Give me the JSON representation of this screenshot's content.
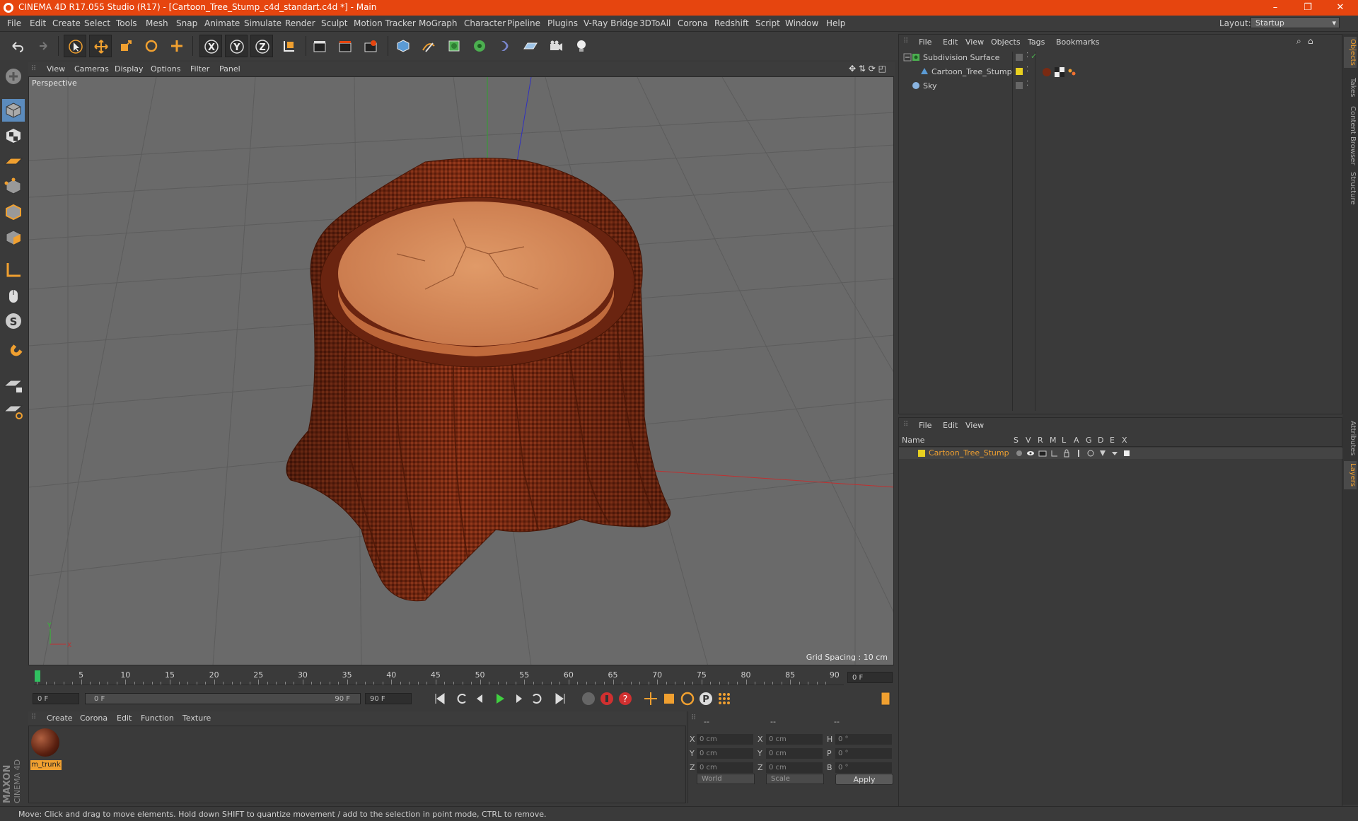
{
  "window": {
    "title": "CINEMA 4D R17.055 Studio (R17) - [Cartoon_Tree_Stump_c4d_standart.c4d *] - Main",
    "buttons": {
      "minimize": "–",
      "restore": "❐",
      "close": "✕"
    }
  },
  "menu": [
    "File",
    "Edit",
    "Create",
    "Select",
    "Tools",
    "Mesh",
    "Snap",
    "Animate",
    "Simulate",
    "Render",
    "Sculpt",
    "Motion Tracker",
    "MoGraph",
    "Character",
    "Pipeline",
    "Plugins",
    "V-Ray Bridge",
    "3DToAll",
    "Corona",
    "Redshift",
    "Script",
    "Window",
    "Help"
  ],
  "layout": {
    "label": "Layout:",
    "value": "Startup"
  },
  "viewport": {
    "menu": [
      "View",
      "Cameras",
      "Display",
      "Options",
      "Filter",
      "Panel"
    ],
    "label": "Perspective",
    "grid_spacing": "Grid Spacing : 10 cm"
  },
  "timeline": {
    "ticks": [
      "0",
      "5",
      "10",
      "15",
      "20",
      "25",
      "30",
      "35",
      "40",
      "45",
      "50",
      "55",
      "60",
      "65",
      "70",
      "75",
      "80",
      "85",
      "90"
    ],
    "current_frame": "0 F"
  },
  "playback": {
    "start": "0 F",
    "range_start": "0 F",
    "range_end": "90 F",
    "end": "90 F"
  },
  "material_manager": {
    "menu": [
      "Create",
      "Corona",
      "Edit",
      "Function",
      "Texture"
    ],
    "materials": [
      {
        "name": "m_trunk"
      }
    ]
  },
  "coordinates": {
    "headers": [
      "--",
      "--",
      "--"
    ],
    "rows": [
      {
        "a": "X",
        "a_val": "0 cm",
        "b": "X",
        "b_val": "0 cm",
        "c": "H",
        "c_val": "0 °"
      },
      {
        "a": "Y",
        "a_val": "0 cm",
        "b": "Y",
        "b_val": "0 cm",
        "c": "P",
        "c_val": "0 °"
      },
      {
        "a": "Z",
        "a_val": "0 cm",
        "b": "Z",
        "b_val": "0 cm",
        "c": "B",
        "c_val": "0 °"
      }
    ],
    "space": "World",
    "mode": "Scale",
    "apply": "Apply"
  },
  "object_manager": {
    "menu": [
      "File",
      "Edit",
      "View",
      "Objects",
      "Tags",
      "Bookmarks"
    ],
    "objects": [
      {
        "name": "Subdivision Surface"
      },
      {
        "name": "Cartoon_Tree_Stump"
      },
      {
        "name": "Sky"
      }
    ]
  },
  "layer_manager": {
    "menu": [
      "File",
      "Edit",
      "View"
    ],
    "columns": [
      "Name",
      "S",
      "V",
      "R",
      "M",
      "L",
      "A",
      "G",
      "D",
      "E",
      "X"
    ],
    "layers": [
      {
        "name": "Cartoon_Tree_Stump"
      }
    ]
  },
  "right_tabs": [
    "Objects",
    "Takes",
    "Content Browser",
    "Structure",
    "Attributes",
    "Layers"
  ],
  "status": "Move: Click and drag to move elements. Hold down SHIFT to quantize movement / add to the selection in point mode, CTRL to remove.",
  "branding": {
    "logo_text": "MAXON CINEMA 4D"
  },
  "colors": {
    "title_bar": "#e6450f",
    "selection": "#5b8bbd",
    "highlight": "#f0a030"
  }
}
